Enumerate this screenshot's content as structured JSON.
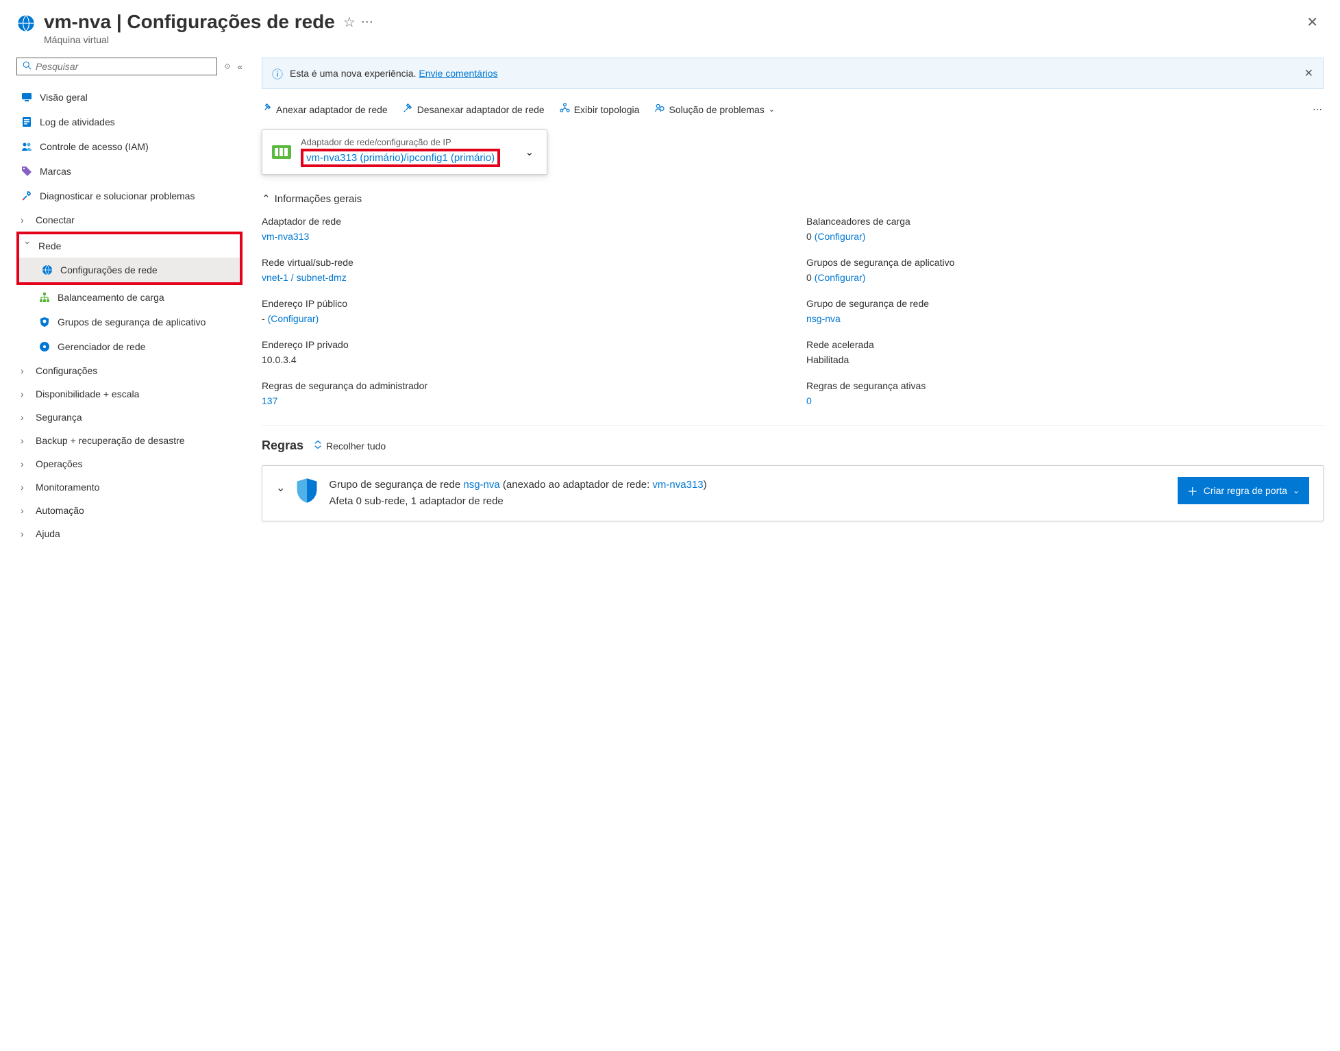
{
  "header": {
    "title": "vm-nva | Configurações de rede",
    "subtitle": "Máquina virtual"
  },
  "search": {
    "placeholder": "Pesquisar"
  },
  "sidebar": {
    "overview": "Visão geral",
    "activity_log": "Log de atividades",
    "iam": "Controle de acesso (IAM)",
    "tags": "Marcas",
    "diagnose": "Diagnosticar e solucionar problemas",
    "connect": "Conectar",
    "networking": "Rede",
    "network_settings": "Configurações de rede",
    "load_balancing": "Balanceamento de carga",
    "asg": "Grupos de segurança de aplicativo",
    "network_manager": "Gerenciador de rede",
    "settings": "Configurações",
    "availability": "Disponibilidade + escala",
    "security": "Segurança",
    "backup": "Backup + recuperação de desastre",
    "operations": "Operações",
    "monitoring": "Monitoramento",
    "automation": "Automação",
    "help": "Ajuda"
  },
  "banner": {
    "text": "Esta é uma nova experiência. ",
    "link": "Envie comentários"
  },
  "toolbar": {
    "attach": "Anexar adaptador de rede",
    "detach": "Desanexar adaptador de rede",
    "topology": "Exibir topologia",
    "troubleshoot": "Solução de problemas"
  },
  "nic_selector": {
    "label": "Adaptador de rede/configuração de IP",
    "value": "vm-nva313 (primário)/ipconfig1 (primário)"
  },
  "general_info_title": "Informações gerais",
  "info": {
    "nic_label": "Adaptador de rede",
    "nic_value": "vm-nva313",
    "lb_label": "Balanceadores de carga",
    "lb_count": "0 ",
    "lb_link": "(Configurar)",
    "vnet_label": "Rede virtual/sub-rede",
    "vnet_value": "vnet-1 / subnet-dmz",
    "asg_label": "Grupos de segurança de aplicativo",
    "asg_count": "0 ",
    "asg_link": "(Configurar)",
    "pip_label": "Endereço IP público",
    "pip_dash": "- ",
    "pip_link": "(Configurar)",
    "nsg_label": "Grupo de segurança de rede",
    "nsg_value": "nsg-nva",
    "privip_label": "Endereço IP privado",
    "privip_value": "10.0.3.4",
    "accel_label": "Rede acelerada",
    "accel_value": "Habilitada",
    "admin_rules_label": "Regras de segurança do administrador",
    "admin_rules_value": "137",
    "active_rules_label": "Regras de segurança ativas",
    "active_rules_value": "0"
  },
  "rules": {
    "title": "Regras",
    "collapse_all": "Recolher tudo",
    "nsg_prefix": "Grupo de segurança de rede ",
    "nsg_name": "nsg-nva",
    "nsg_attached": " (anexado ao adaptador de rede: ",
    "nic_name": "vm-nva313",
    "nsg_close": ")",
    "affects": "Afeta 0 sub-rede, 1 adaptador de rede",
    "create_rule": "Criar regra de porta"
  }
}
